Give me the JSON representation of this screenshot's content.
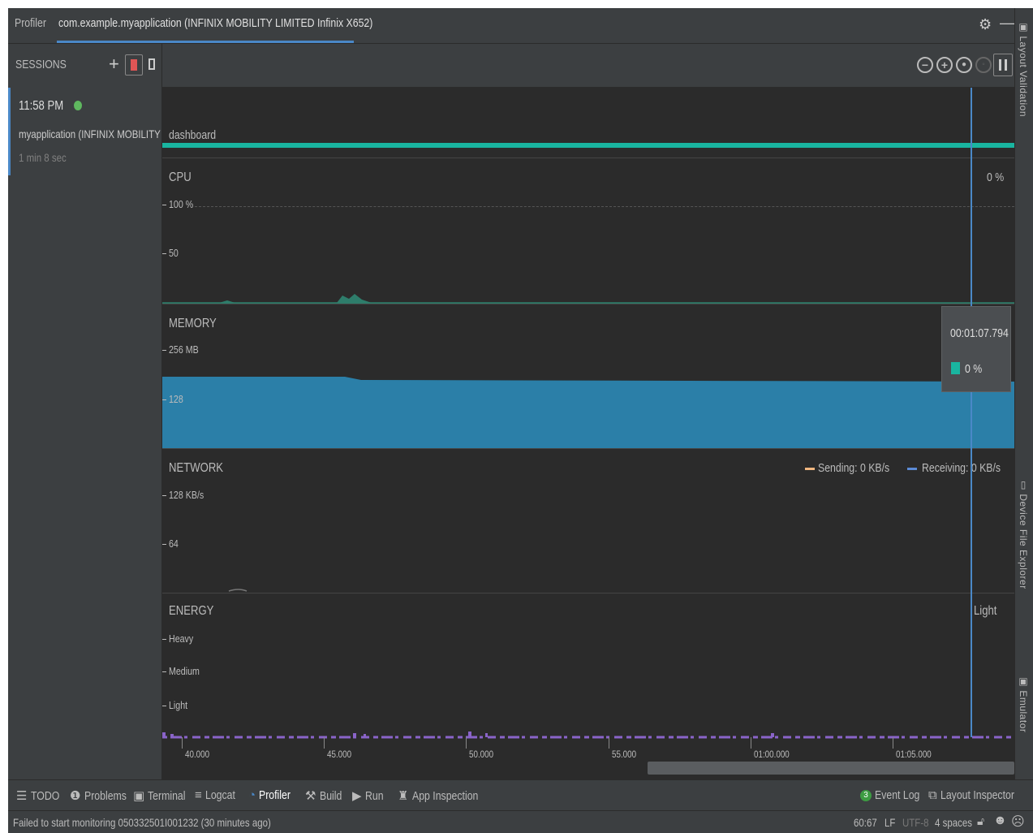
{
  "tabs": {
    "profiler": "Profiler",
    "app": "com.example.myapplication (INFINIX MOBILITY LIMITED Infinix X652)"
  },
  "right_tools": {
    "layout_validation": "Layout Validation",
    "device_file_explorer": "Device File Explorer",
    "emulator": "Emulator"
  },
  "sessions": {
    "title": "SESSIONS",
    "item": {
      "time": "11:58 PM",
      "name": "myapplication (INFINIX MOBILITY L...",
      "duration": "1 min 8 sec"
    }
  },
  "monitors": {
    "activity": "dashboard",
    "cpu": {
      "title": "CPU",
      "value": "0 %",
      "tick_high": "100 %",
      "tick_mid": "50"
    },
    "memory": {
      "title": "MEMORY",
      "tick_high": "256 MB",
      "tick_mid": "128"
    },
    "network": {
      "title": "NETWORK",
      "tick_high": "128 KB/s",
      "tick_mid": "64",
      "legend_sending": "Sending: 0 KB/s",
      "legend_receiving": "Receiving: 0 KB/s"
    },
    "energy": {
      "title": "ENERGY",
      "tick_heavy": "Heavy",
      "tick_medium": "Medium",
      "tick_light": "Light",
      "value": "Light"
    },
    "tooltip": {
      "time": "00:01:07.794",
      "value": "0 %"
    },
    "time_axis": [
      "40.000",
      "45.000",
      "50.000",
      "55.000",
      "01:00.000",
      "01:05.000"
    ]
  },
  "bottom_tools": {
    "todo": "TODO",
    "problems": "Problems",
    "terminal": "Terminal",
    "logcat": "Logcat",
    "profiler": "Profiler",
    "build": "Build",
    "run": "Run",
    "app_inspection": "App Inspection",
    "event_log_count": "3",
    "event_log": "Event Log",
    "layout_inspector": "Layout Inspector"
  },
  "status": {
    "message": "Failed to start monitoring 050332501I001232 (30 minutes ago)",
    "position": "60:67",
    "line_sep": "LF",
    "encoding": "UTF-8",
    "indent": "4 spaces"
  },
  "colors": {
    "accent": "#4a88c7",
    "activity_bar": "#19b5a0",
    "cpu": "#2e7d6b",
    "memory": "#2b7fa8",
    "sending": "#f0b67f",
    "receiving": "#5c8bd6",
    "energy": "#8a64c9",
    "recording": "#e05555",
    "live": "#5fb85f"
  }
}
